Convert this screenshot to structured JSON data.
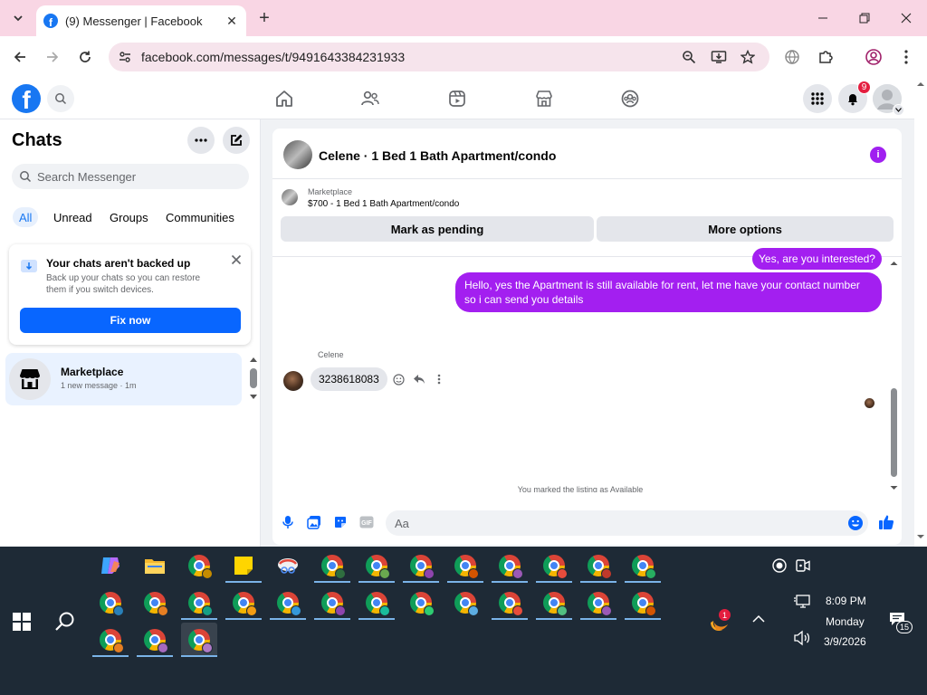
{
  "browser": {
    "tab_title": "(9) Messenger | Facebook",
    "url": "facebook.com/messages/t/9491643384231933"
  },
  "header": {
    "notification_count": "9"
  },
  "left_panel": {
    "title": "Chats",
    "search_placeholder": "Search Messenger",
    "filters": [
      {
        "label": "All",
        "active": true
      },
      {
        "label": "Unread",
        "active": false
      },
      {
        "label": "Groups",
        "active": false
      },
      {
        "label": "Communities",
        "active": false
      }
    ],
    "backup_card": {
      "title": "Your chats aren't backed up",
      "body": "Back up your chats so you can restore them if you switch devices.",
      "button": "Fix now"
    },
    "conversations": [
      {
        "name": "Marketplace",
        "subtitle": "1 new message · 1m"
      }
    ]
  },
  "chat": {
    "title": "Celene · 1 Bed 1 Bath Apartment/condo",
    "listing": {
      "label": "Marketplace",
      "price_title": "$700 - 1 Bed 1 Bath Apartment/condo",
      "mark_pending": "Mark as pending",
      "more_options": "More options"
    },
    "messages": {
      "out1": "Yes, are you interested?",
      "out2": "Hello, yes the Apartment is still available for rent, let me have your contact number so i can send you details",
      "in_sender": "Celene",
      "in1": "3238618083"
    },
    "system_message": "You marked the listing as Available",
    "composer_placeholder": "Aa"
  },
  "taskbar": {
    "time": "8:09 PM",
    "day": "Monday",
    "date": "3/9/2026",
    "notification_count": "15",
    "tray_badge": "1"
  },
  "colors": {
    "fb_blue": "#1877f2",
    "bubble_purple": "#a31ff0",
    "taskbar": "#1e2a36"
  }
}
